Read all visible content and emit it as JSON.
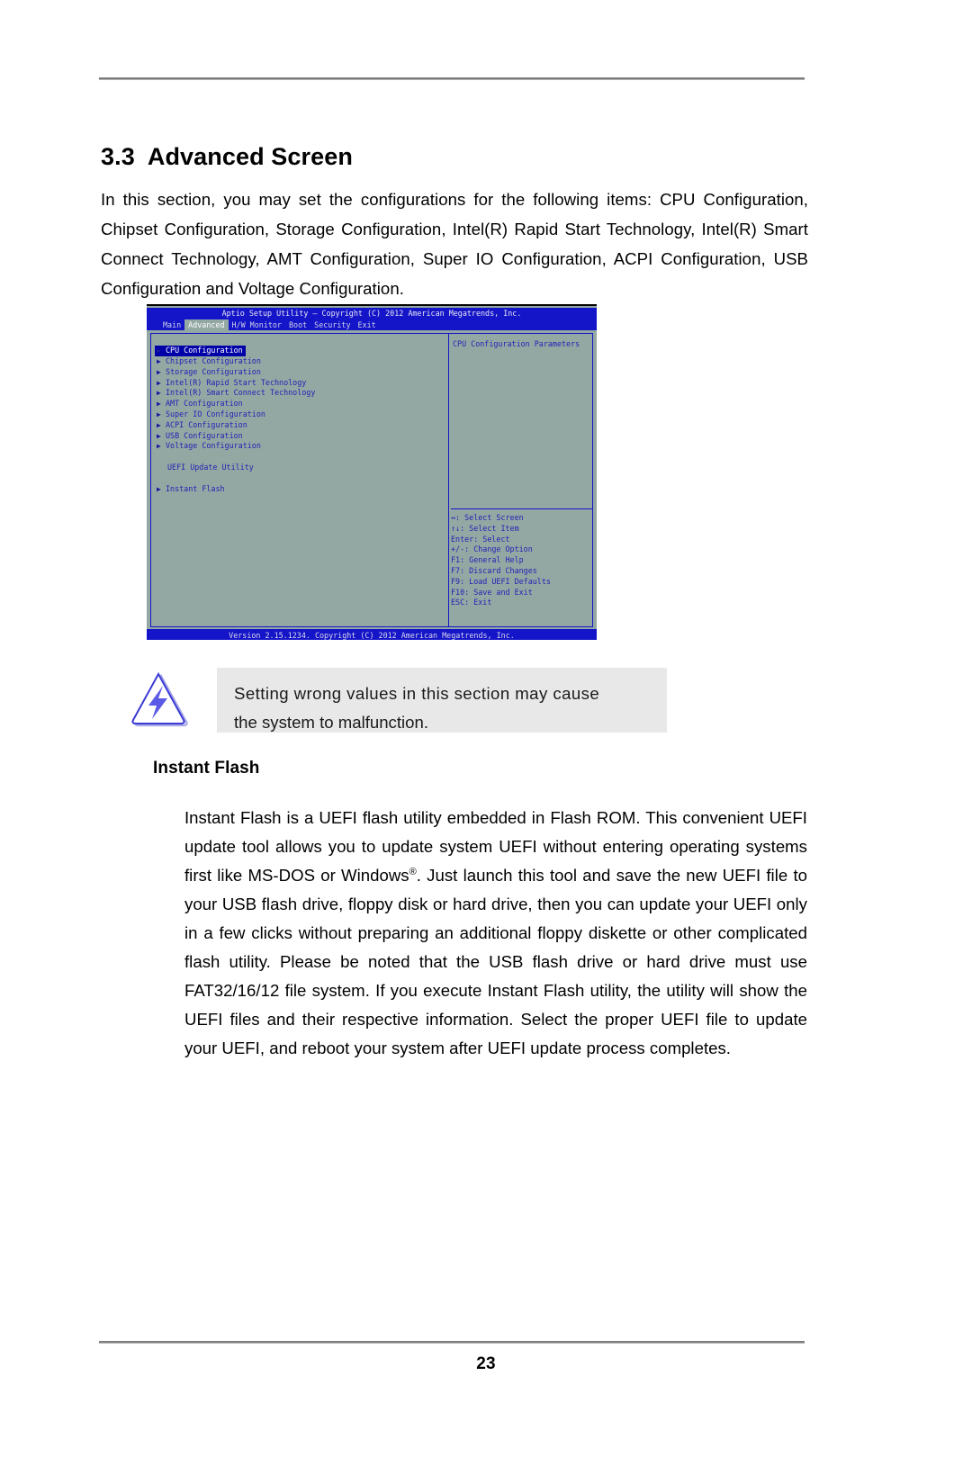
{
  "document": {
    "page_number": "23",
    "section_number": "3.3",
    "section_title": "Advanced Screen",
    "intro_paragraph": "In this section, you may set the configurations for the following items: CPU Configuration, Chipset Configuration, Storage Configuration, Intel(R) Rapid Start Technology, Intel(R) Smart Connect Technology, AMT Configuration, Super IO Configuration, ACPI Configuration, USB Configuration and Voltage Configuration."
  },
  "bios": {
    "title": "Aptio Setup Utility – Copyright (C) 2012 American Megatrends, Inc.",
    "footer": "Version 2.15.1234. Copyright (C) 2012 American Megatrends, Inc.",
    "tabs": [
      {
        "label": "Main",
        "active": false
      },
      {
        "label": "Advanced",
        "active": true
      },
      {
        "label": "H/W Monitor",
        "active": false
      },
      {
        "label": "Boot",
        "active": false
      },
      {
        "label": "Security",
        "active": false
      },
      {
        "label": "Exit",
        "active": false
      }
    ],
    "menu_items": [
      {
        "label": "CPU Configuration",
        "selected": true,
        "arrow": true
      },
      {
        "label": "Chipset Configuration",
        "selected": false,
        "arrow": true
      },
      {
        "label": "Storage Configuration",
        "selected": false,
        "arrow": true
      },
      {
        "label": "Intel(R) Rapid Start Technology",
        "selected": false,
        "arrow": true
      },
      {
        "label": "Intel(R) Smart Connect Technology",
        "selected": false,
        "arrow": true
      },
      {
        "label": "AMT Configuration",
        "selected": false,
        "arrow": true
      },
      {
        "label": "Super IO Configuration",
        "selected": false,
        "arrow": true
      },
      {
        "label": "ACPI Configuration",
        "selected": false,
        "arrow": true
      },
      {
        "label": "USB Configuration",
        "selected": false,
        "arrow": true
      },
      {
        "label": "Voltage Configuration",
        "selected": false,
        "arrow": true
      }
    ],
    "group_label": "UEFI Update Utility",
    "group_item": {
      "label": "Instant Flash",
      "arrow": true
    },
    "help_description": "CPU Configuration Parameters",
    "hotkeys": [
      "↔: Select Screen",
      "↑↓: Select Item",
      "Enter: Select",
      "+/-: Change Option",
      "F1: General Help",
      "F7: Discard Changes",
      "F9: Load UEFI Defaults",
      "F10: Save and Exit",
      "ESC: Exit"
    ]
  },
  "note": {
    "icon": "warning-triangle-lightning-icon",
    "line1": "Setting wrong values in this section may cause",
    "line2": "the system to malfunction."
  },
  "instant_flash": {
    "heading": "Instant Flash",
    "body_part1": "Instant Flash is a UEFI flash utility embedded in Flash ROM. This convenient UEFI update tool allows you to update system UEFI without entering operating systems first like MS-DOS or Windows",
    "registered_mark": "®",
    "body_part2": ". Just launch this tool and save the new UEFI file to your USB flash drive, floppy disk or hard drive, then you can update your UEFI only in a few clicks without preparing an additional floppy diskette or other complicated flash utility. Please be noted that the USB flash drive or hard drive must use FAT32/16/12 file system. If you execute Instant Flash utility, the utility will show the UEFI files and their respective information. Select the proper UEFI file to update your UEFI, and reboot your system after UEFI update process completes."
  },
  "colors": {
    "bios_background": "#94a8a3",
    "bios_chrome_blue": "#1414c8",
    "bios_text_blue": "#2222b4",
    "bios_selection": "#0000a8",
    "note_background": "#e8e8e8",
    "note_icon_accent": "#5a5ae6"
  }
}
